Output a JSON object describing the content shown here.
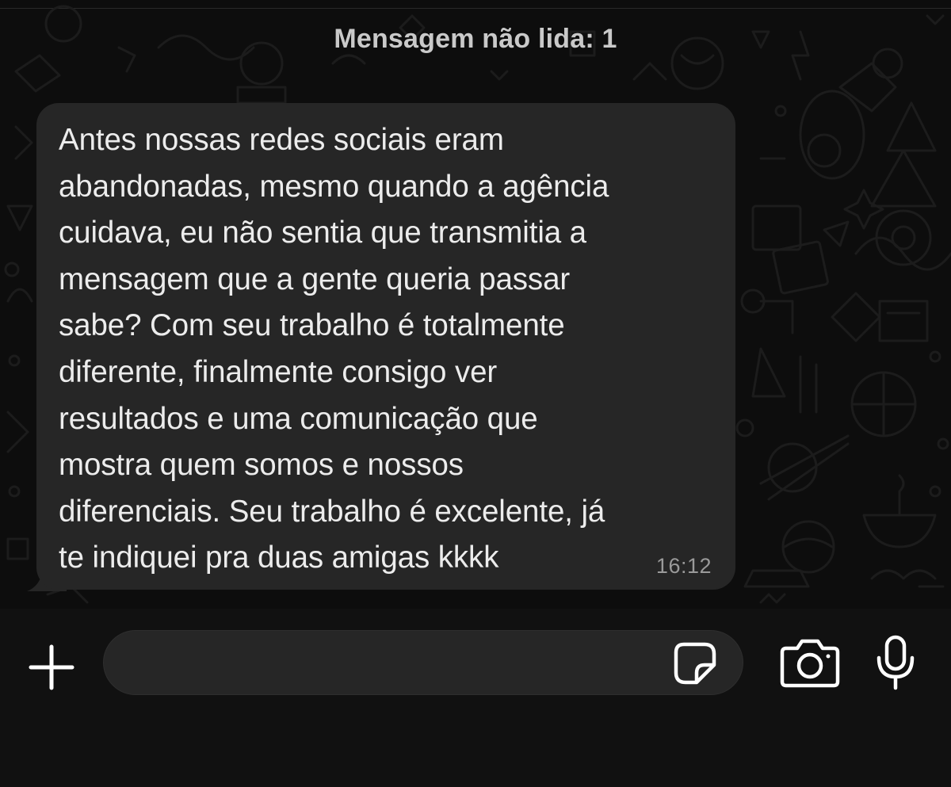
{
  "chat": {
    "unread_banner": "Mensagem não lida: 1",
    "message": {
      "text": "Antes nossas redes sociais eram\nabandonadas, mesmo quando a agência\ncuidava, eu não sentia que transmitia a\nmensagem que a gente queria passar\nsabe? Com seu trabalho é totalmente\ndiferente, finalmente consigo ver\nresultados e uma comunicação que\nmostra quem somos e nossos\ndiferenciais. Seu trabalho é excelente, já\nte indiquei pra duas amigas kkkk",
      "time": "16:12"
    }
  },
  "input_bar": {
    "message_value": "",
    "icons": {
      "plus": "plus-icon",
      "sticker": "sticker-icon",
      "camera": "camera-icon",
      "mic": "microphone-icon"
    }
  },
  "colors": {
    "background": "#0d0d0d",
    "bubble": "#262626",
    "text": "#ececec",
    "timestamp": "#9a9a9a",
    "banner": "#c9c9c9",
    "icons": "#ffffff"
  }
}
